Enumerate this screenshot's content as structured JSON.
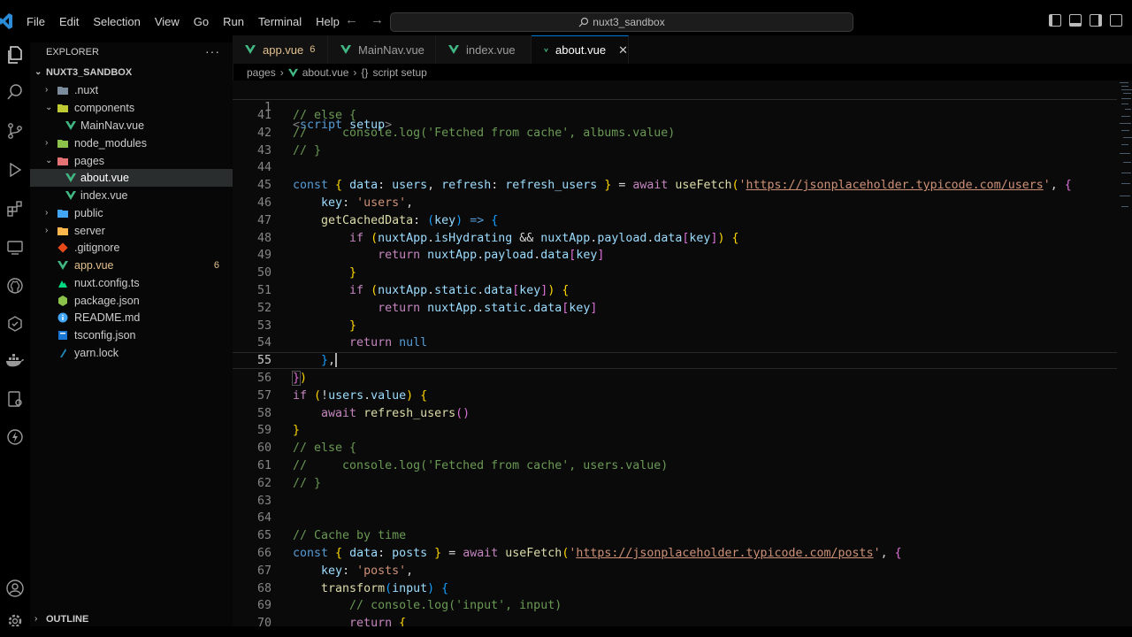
{
  "menu": [
    "File",
    "Edit",
    "Selection",
    "View",
    "Go",
    "Run",
    "Terminal",
    "Help"
  ],
  "search": {
    "text": "nuxt3_sandbox"
  },
  "explorer": {
    "header": "EXPLORER",
    "project": "NUXT3_SANDBOX",
    "items": [
      {
        "name": ".nuxt",
        "badge": ""
      },
      {
        "name": "components",
        "badge": ""
      },
      {
        "name": "MainNav.vue",
        "badge": ""
      },
      {
        "name": "node_modules",
        "badge": ""
      },
      {
        "name": "pages",
        "badge": ""
      },
      {
        "name": "about.vue",
        "badge": ""
      },
      {
        "name": "index.vue",
        "badge": ""
      },
      {
        "name": "public",
        "badge": ""
      },
      {
        "name": "server",
        "badge": ""
      },
      {
        "name": ".gitignore",
        "badge": ""
      },
      {
        "name": "app.vue",
        "badge": "6"
      },
      {
        "name": "nuxt.config.ts",
        "badge": ""
      },
      {
        "name": "package.json",
        "badge": ""
      },
      {
        "name": "README.md",
        "badge": ""
      },
      {
        "name": "tsconfig.json",
        "badge": ""
      },
      {
        "name": "yarn.lock",
        "badge": ""
      }
    ],
    "outline": "OUTLINE"
  },
  "tabs": [
    {
      "label": "app.vue",
      "badge": "6"
    },
    {
      "label": "MainNav.vue",
      "badge": ""
    },
    {
      "label": "index.vue",
      "badge": ""
    },
    {
      "label": "about.vue",
      "badge": ""
    }
  ],
  "breadcrumb": {
    "folder": "pages",
    "file": "about.vue",
    "symbol": "script setup"
  },
  "sticky": {
    "number": "1"
  },
  "line_numbers": [
    "41",
    "42",
    "43",
    "44",
    "45",
    "46",
    "47",
    "48",
    "49",
    "50",
    "51",
    "52",
    "53",
    "54",
    "55",
    "56",
    "57",
    "58",
    "59",
    "60",
    "61",
    "62",
    "63",
    "64",
    "65",
    "66",
    "67",
    "68",
    "69",
    "70"
  ],
  "code": {
    "sticky_kw": "setup",
    "url_users": "https://jsonplaceholder.typicode.com/users",
    "url_posts": "https://jsonplaceholder.typicode.com/posts",
    "cm41": "// else {",
    "cm42": "//     console.log('Fetched from cache', albums.value)",
    "cm43": "// }",
    "cm60": "// else {",
    "cm61": "//     console.log('Fetched from cache', users.value)",
    "cm62": "// }",
    "cm65": "// Cache by time",
    "cm69": "// console.log('input', input)",
    "str_users": "'users'",
    "str_posts": "'posts'"
  }
}
